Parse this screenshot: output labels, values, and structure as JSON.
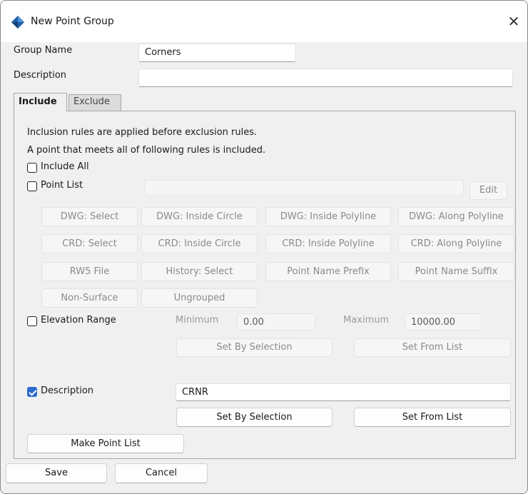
{
  "window": {
    "title": "New Point Group",
    "close_glyph": "✕"
  },
  "fields": {
    "group_name_label": "Group Name",
    "group_name_value": "Corners",
    "description_label": "Description",
    "description_value": ""
  },
  "tabs": [
    {
      "label": "Include"
    },
    {
      "label": "Exclude"
    }
  ],
  "include": {
    "info1": "Inclusion rules are applied before exclusion rules.",
    "info2": "A point that meets all of following rules is included.",
    "include_all": {
      "label": "Include All",
      "checked": false
    },
    "point_list": {
      "label": "Point List",
      "checked": false,
      "value": "",
      "edit_label": "Edit"
    },
    "grid_buttons": [
      "DWG: Select",
      "DWG: Inside Circle",
      "DWG: Inside Polyline",
      "DWG: Along Polyline",
      "CRD: Select",
      "CRD: Inside Circle",
      "CRD: Inside Polyline",
      "CRD: Along Polyline",
      "RW5 File",
      "History: Select",
      "Point Name Prefix",
      "Point Name Suffix",
      "Non-Surface",
      "Ungrouped"
    ],
    "elevation_range": {
      "label": "Elevation Range",
      "checked": false,
      "min_label": "Minimum",
      "min_value": "0.00",
      "max_label": "Maximum",
      "max_value": "10000.00",
      "set_by_selection": "Set By Selection",
      "set_from_list": "Set From List"
    },
    "description": {
      "label": "Description",
      "checked": true,
      "value": "CRNR",
      "set_by_selection": "Set By Selection",
      "set_from_list": "Set From List"
    },
    "make_point_list": "Make Point List"
  },
  "footer": {
    "save": "Save",
    "cancel": "Cancel"
  },
  "colors": {
    "accent": "#2d6bd1",
    "icon": "#1f5fa8"
  },
  "icons": {
    "app": "diamond-app-icon",
    "close": "close-icon",
    "check": "check-icon"
  }
}
